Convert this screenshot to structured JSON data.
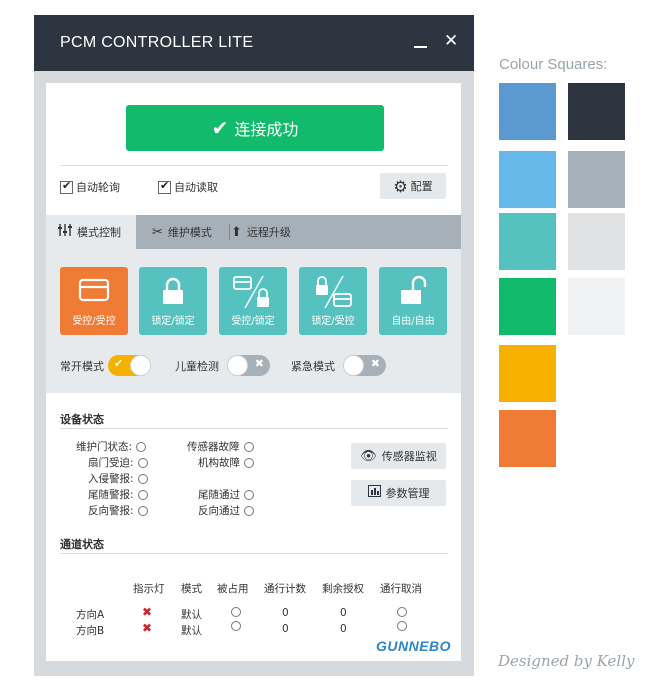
{
  "window": {
    "title": "PCM CONTROLLER LITE",
    "minimize_label": "_",
    "close_label": "✕"
  },
  "connect": {
    "icon": "✔",
    "label": "连接成功",
    "color": "#12bb6b"
  },
  "options": {
    "auto_poll": {
      "label": "自动轮询",
      "checked": true
    },
    "auto_read": {
      "label": "自动读取",
      "checked": true
    },
    "config_icon": "gear-icon",
    "config_label": "配置"
  },
  "tabs": [
    {
      "label": "模式控制",
      "icon": "sliders-icon",
      "active": true
    },
    {
      "label": "维护模式",
      "icon": "tools-icon",
      "active": false
    },
    {
      "label": "远程升级",
      "icon": "arrow-up-icon",
      "active": false
    }
  ],
  "modes": [
    {
      "label": "受控/受控",
      "active": true
    },
    {
      "label": "锁定/锁定",
      "active": false
    },
    {
      "label": "受控/锁定",
      "active": false
    },
    {
      "label": "锁定/受控",
      "active": false
    },
    {
      "label": "自由/自由",
      "active": false
    }
  ],
  "toggles": [
    {
      "label": "常开模式",
      "on": true,
      "mark": "✔"
    },
    {
      "label": "儿童检测",
      "on": false,
      "mark": "✖"
    },
    {
      "label": "紧急模式",
      "on": false,
      "mark": "✖"
    }
  ],
  "device_status": {
    "title": "设备状态",
    "left": [
      {
        "label": "维护门状态:"
      },
      {
        "label": "扇门受迫:"
      },
      {
        "label": "入侵警报:"
      },
      {
        "label": "尾随警报:"
      },
      {
        "label": "反向警报:"
      }
    ],
    "right": [
      {
        "label": "传感器故障"
      },
      {
        "label": "机构故障"
      },
      {
        "label": "尾随通过"
      },
      {
        "label": "反向通过"
      }
    ],
    "sensor_monitor_label": "传感器监视",
    "param_manage_label": "参数管理"
  },
  "channel_status": {
    "title": "通道状态",
    "headers": [
      "指示灯",
      "模式",
      "被占用",
      "通行计数",
      "剩余授权",
      "通行取消"
    ],
    "rows": [
      {
        "name": "方向A",
        "indicator": "✖",
        "mode": "默认",
        "count": "0",
        "remaining": "0"
      },
      {
        "name": "方向B",
        "indicator": "✖",
        "mode": "默认",
        "count": "0",
        "remaining": "0"
      }
    ]
  },
  "logo": "GUNNEBO",
  "colour_squares": {
    "title": "Colour Squares:",
    "colors": [
      "#5a9ad1",
      "#2d3640",
      "#65b8e8",
      "#a5b0b8",
      "#55c2bf",
      "#e0e2e4",
      "#12bb6b",
      "#f1f2f4",
      "#f5b000",
      "#ef7b35"
    ]
  },
  "signature": "Designed by Kelly"
}
